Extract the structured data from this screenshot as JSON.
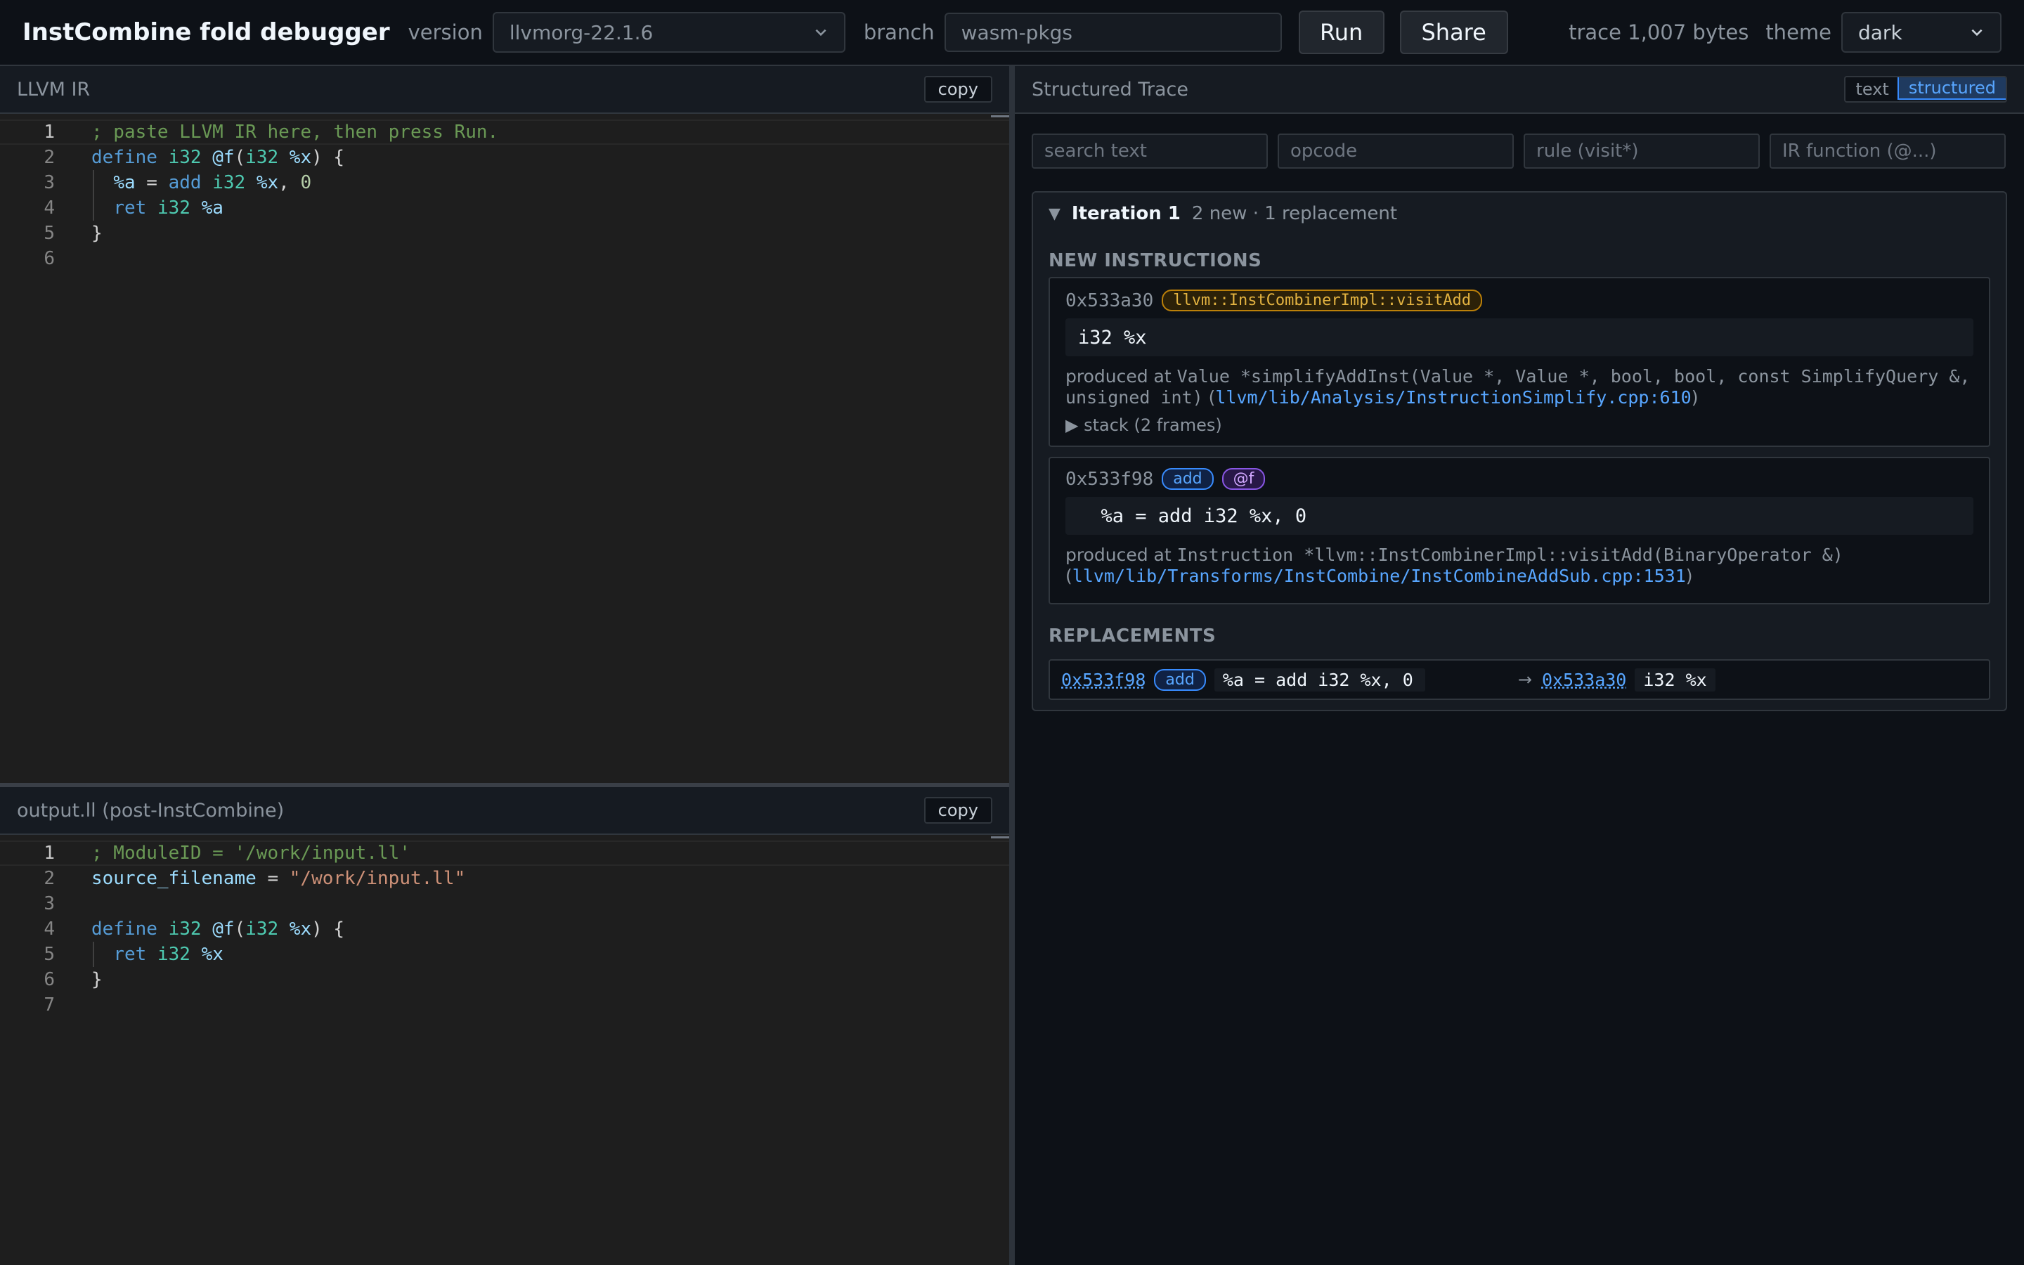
{
  "topbar": {
    "title": "InstCombine fold debugger",
    "version_label": "version",
    "version_value": "llvmorg-22.1.6",
    "branch_label": "branch",
    "branch_value": "wasm-pkgs",
    "run_label": "Run",
    "share_label": "Share",
    "trace_size": "trace 1,007 bytes",
    "theme_label": "theme",
    "theme_value": "dark"
  },
  "input_pane": {
    "title": "LLVM IR",
    "copy_label": "copy",
    "line_numbers": [
      "1",
      "2",
      "3",
      "4",
      "5",
      "6"
    ],
    "lines": [
      [
        {
          "t": "; paste LLVM IR here, then press Run.",
          "c": "comment"
        }
      ],
      [
        {
          "t": "define",
          "c": "kw"
        },
        {
          "t": " ",
          "c": "plain"
        },
        {
          "t": "i32",
          "c": "type"
        },
        {
          "t": " ",
          "c": "plain"
        },
        {
          "t": "@f",
          "c": "var"
        },
        {
          "t": "(",
          "c": "plain"
        },
        {
          "t": "i32",
          "c": "type"
        },
        {
          "t": " ",
          "c": "plain"
        },
        {
          "t": "%x",
          "c": "var"
        },
        {
          "t": ") {",
          "c": "plain"
        }
      ],
      [
        {
          "t": "  ",
          "c": "plain"
        },
        {
          "t": "%a",
          "c": "var"
        },
        {
          "t": " = ",
          "c": "plain"
        },
        {
          "t": "add",
          "c": "kw"
        },
        {
          "t": " ",
          "c": "plain"
        },
        {
          "t": "i32",
          "c": "type"
        },
        {
          "t": " ",
          "c": "plain"
        },
        {
          "t": "%x",
          "c": "var"
        },
        {
          "t": ", ",
          "c": "plain"
        },
        {
          "t": "0",
          "c": "num"
        }
      ],
      [
        {
          "t": "  ",
          "c": "plain"
        },
        {
          "t": "ret",
          "c": "kw"
        },
        {
          "t": " ",
          "c": "plain"
        },
        {
          "t": "i32",
          "c": "type"
        },
        {
          "t": " ",
          "c": "plain"
        },
        {
          "t": "%a",
          "c": "var"
        }
      ],
      [
        {
          "t": "}",
          "c": "plain"
        }
      ],
      []
    ]
  },
  "output_pane": {
    "title": "output.ll (post-InstCombine)",
    "copy_label": "copy",
    "line_numbers": [
      "1",
      "2",
      "3",
      "4",
      "5",
      "6",
      "7"
    ],
    "lines": [
      [
        {
          "t": "; ModuleID = '/work/input.ll'",
          "c": "comment"
        }
      ],
      [
        {
          "t": "source_filename",
          "c": "var"
        },
        {
          "t": " = ",
          "c": "plain"
        },
        {
          "t": "\"/work/input.ll\"",
          "c": "str"
        }
      ],
      [],
      [
        {
          "t": "define",
          "c": "kw"
        },
        {
          "t": " ",
          "c": "plain"
        },
        {
          "t": "i32",
          "c": "type"
        },
        {
          "t": " ",
          "c": "plain"
        },
        {
          "t": "@f",
          "c": "var"
        },
        {
          "t": "(",
          "c": "plain"
        },
        {
          "t": "i32",
          "c": "type"
        },
        {
          "t": " ",
          "c": "plain"
        },
        {
          "t": "%x",
          "c": "var"
        },
        {
          "t": ") {",
          "c": "plain"
        }
      ],
      [
        {
          "t": "  ",
          "c": "plain"
        },
        {
          "t": "ret",
          "c": "kw"
        },
        {
          "t": " ",
          "c": "plain"
        },
        {
          "t": "i32",
          "c": "type"
        },
        {
          "t": " ",
          "c": "plain"
        },
        {
          "t": "%x",
          "c": "var"
        }
      ],
      [
        {
          "t": "}",
          "c": "plain"
        }
      ],
      []
    ]
  },
  "trace": {
    "title": "Structured Trace",
    "view_text": "text",
    "view_structured": "structured",
    "filters": {
      "search": "search text",
      "opcode": "opcode",
      "rule": "rule (visit*)",
      "function": "IR function (@...)"
    },
    "iteration": {
      "title": "Iteration 1",
      "summary": "2 new · 1 replacement",
      "new_heading": "NEW INSTRUCTIONS",
      "repl_heading": "REPLACEMENTS",
      "inst1": {
        "addr": "0x533a30",
        "rule": "llvm::InstCombinerImpl::visitAdd",
        "ir": "i32 %x",
        "produced_prefix": "produced at",
        "sig": "Value *simplifyAddInst(Value *, Value *, bool, bool, const SimplifyQuery &, unsigned int)",
        "loc": "llvm/lib/Analysis/InstructionSimplify.cpp:610",
        "stack": "stack (2 frames)"
      },
      "inst2": {
        "addr": "0x533f98",
        "opcode": "add",
        "fn": "@f",
        "ir": "  %a = add i32 %x, 0",
        "produced_prefix": "produced at",
        "sig": "Instruction *llvm::InstCombinerImpl::visitAdd(BinaryOperator &)",
        "loc": "llvm/lib/Transforms/InstCombine/InstCombineAddSub.cpp:1531"
      },
      "replacement": {
        "from_addr": "0x533f98",
        "from_opcode": "add",
        "from_ir": "%a = add i32 %x, 0",
        "arrow": "→",
        "to_addr": "0x533a30",
        "to_ir": "i32 %x"
      }
    }
  }
}
